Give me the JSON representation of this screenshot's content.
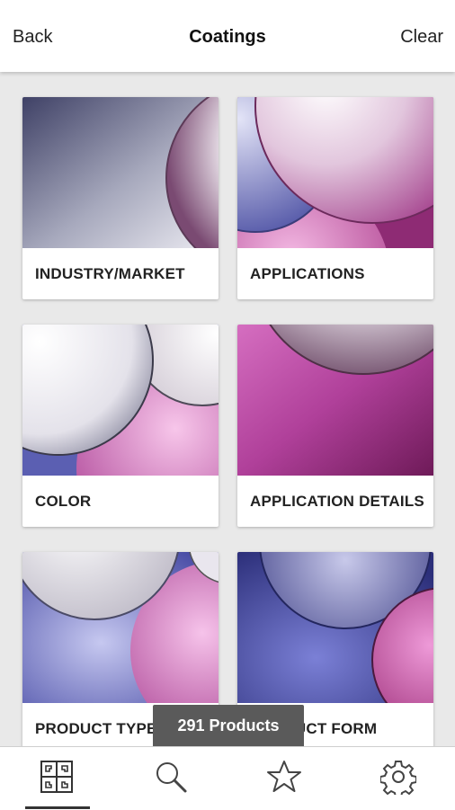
{
  "header": {
    "back_label": "Back",
    "title": "Coatings",
    "clear_label": "Clear"
  },
  "categories": [
    {
      "label": "INDUSTRY/MARKET"
    },
    {
      "label": "APPLICATIONS"
    },
    {
      "label": "COLOR"
    },
    {
      "label": "APPLICATION DETAILS"
    },
    {
      "label": "PRODUCT TYPE"
    },
    {
      "label": "PRODUCT FORM"
    }
  ],
  "toast": {
    "text": "291 Products"
  },
  "nav": {
    "items": [
      {
        "icon": "puzzle-icon",
        "active": true
      },
      {
        "icon": "search-icon",
        "active": false
      },
      {
        "icon": "star-icon",
        "active": false
      },
      {
        "icon": "gear-icon",
        "active": false
      }
    ]
  },
  "colors": {
    "accent_purple": "#b04a9a",
    "accent_blue": "#5a5fb0",
    "toast_bg": "#5a5a5a"
  }
}
